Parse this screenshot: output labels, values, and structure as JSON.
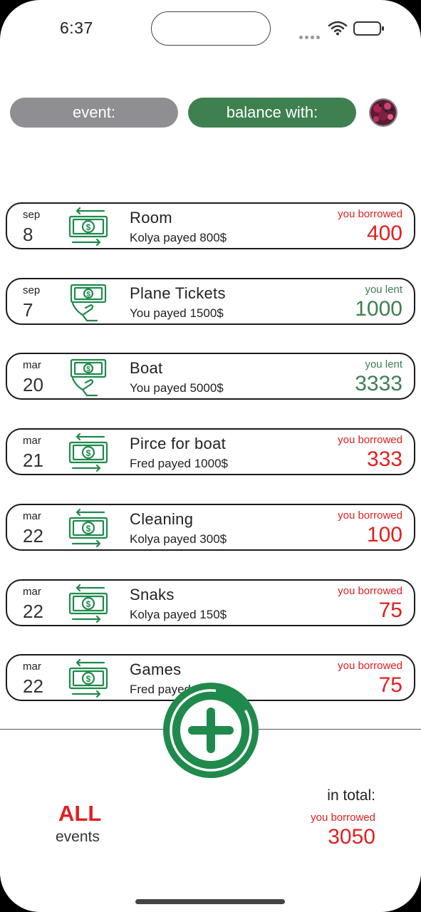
{
  "status_bar": {
    "time": "6:37"
  },
  "filters": {
    "event_label": "event:",
    "balance_label": "balance with:"
  },
  "events": [
    {
      "month": "sep",
      "day": "8",
      "icon": "money-transfer-icon",
      "title": "Room",
      "subtitle": "Kolya payed 800$",
      "type": "you borrowed",
      "amount": "400"
    },
    {
      "month": "sep",
      "day": "7",
      "icon": "money-hand-icon",
      "title": "Plane Tickets",
      "subtitle": "You payed 1500$",
      "type": "you lent",
      "amount": "1000"
    },
    {
      "month": "mar",
      "day": "20",
      "icon": "money-hand-icon",
      "title": "Boat",
      "subtitle": "You payed 5000$",
      "type": "you lent",
      "amount": "3333"
    },
    {
      "month": "mar",
      "day": "21",
      "icon": "money-transfer-icon",
      "title": "Pirce for boat",
      "subtitle": "Fred payed 1000$",
      "type": "you borrowed",
      "amount": "333"
    },
    {
      "month": "mar",
      "day": "22",
      "icon": "money-transfer-icon",
      "title": "Cleaning",
      "subtitle": "Kolya payed 300$",
      "type": "you borrowed",
      "amount": "100"
    },
    {
      "month": "mar",
      "day": "22",
      "icon": "money-transfer-icon",
      "title": "Snaks",
      "subtitle": "Kolya payed 150$",
      "type": "you borrowed",
      "amount": "75"
    },
    {
      "month": "mar",
      "day": "22",
      "icon": "money-transfer-icon",
      "title": "Games",
      "subtitle": "Fred payed",
      "type": "you borrowed",
      "amount": "75"
    }
  ],
  "summary": {
    "all_label": "ALL",
    "all_sub": "events",
    "total_label": "in total:",
    "total_type": "you borrowed",
    "total_value": "3050"
  },
  "colors": {
    "borrowed": "#e02020",
    "lent": "#3e8050",
    "accent": "#1a9a5e"
  }
}
